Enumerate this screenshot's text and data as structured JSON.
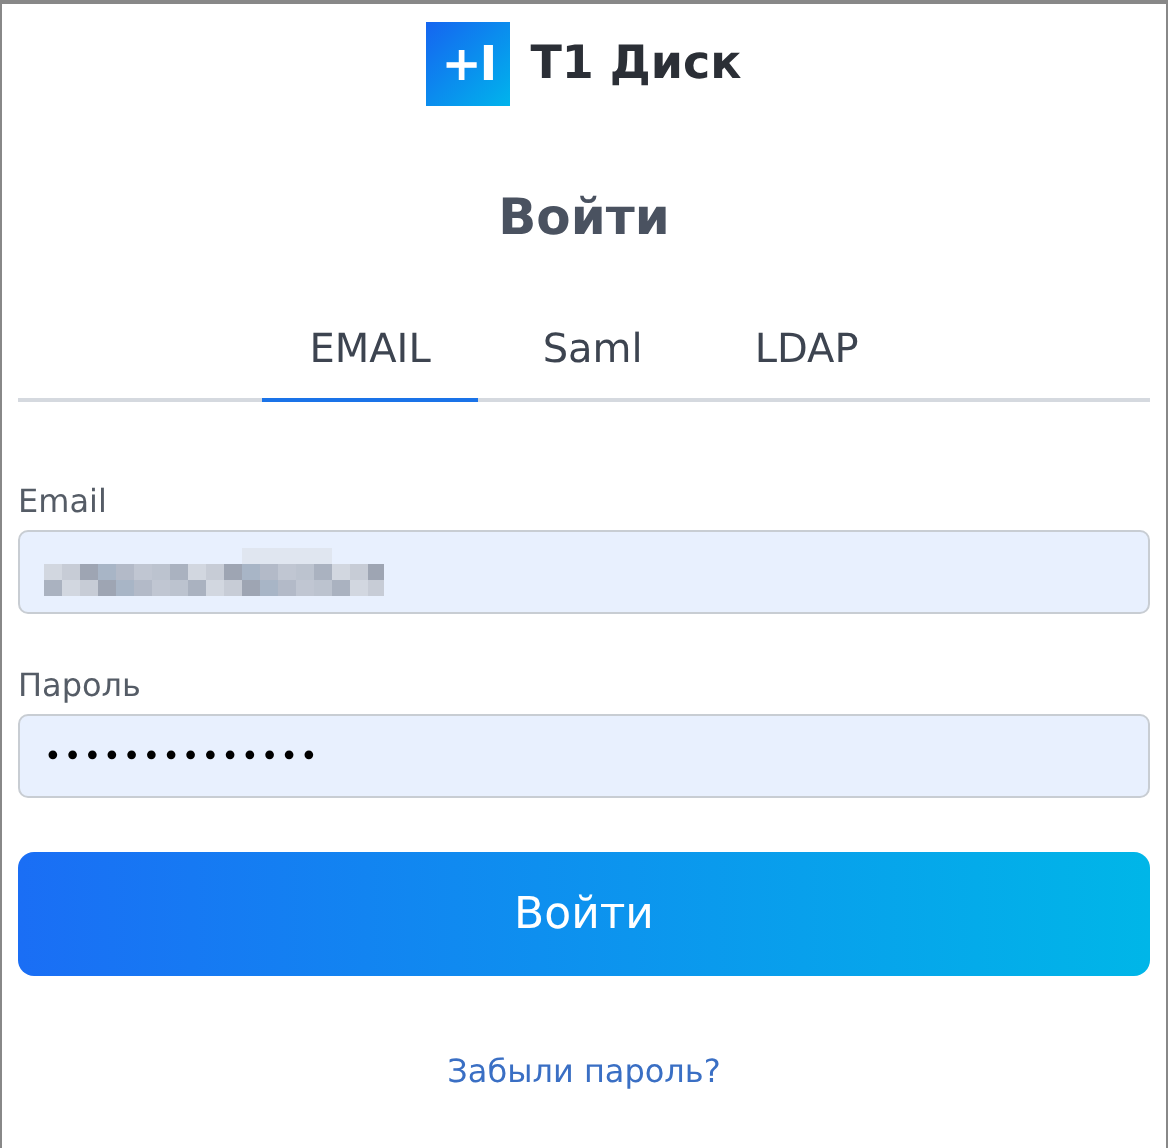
{
  "logo": {
    "mark": "+I",
    "name": "T1 Диск"
  },
  "title": "Войти",
  "tabs": [
    {
      "label": "EMAIL",
      "selected": true
    },
    {
      "label": "Saml",
      "selected": false
    },
    {
      "label": "LDAP",
      "selected": false
    }
  ],
  "fields": [
    {
      "label": "Email",
      "kind": "redacted"
    },
    {
      "label": "Пароль",
      "kind": "password",
      "value": "••••••••••••••"
    }
  ],
  "submit": "Войти",
  "forgot_link": "Забыли пароль?"
}
